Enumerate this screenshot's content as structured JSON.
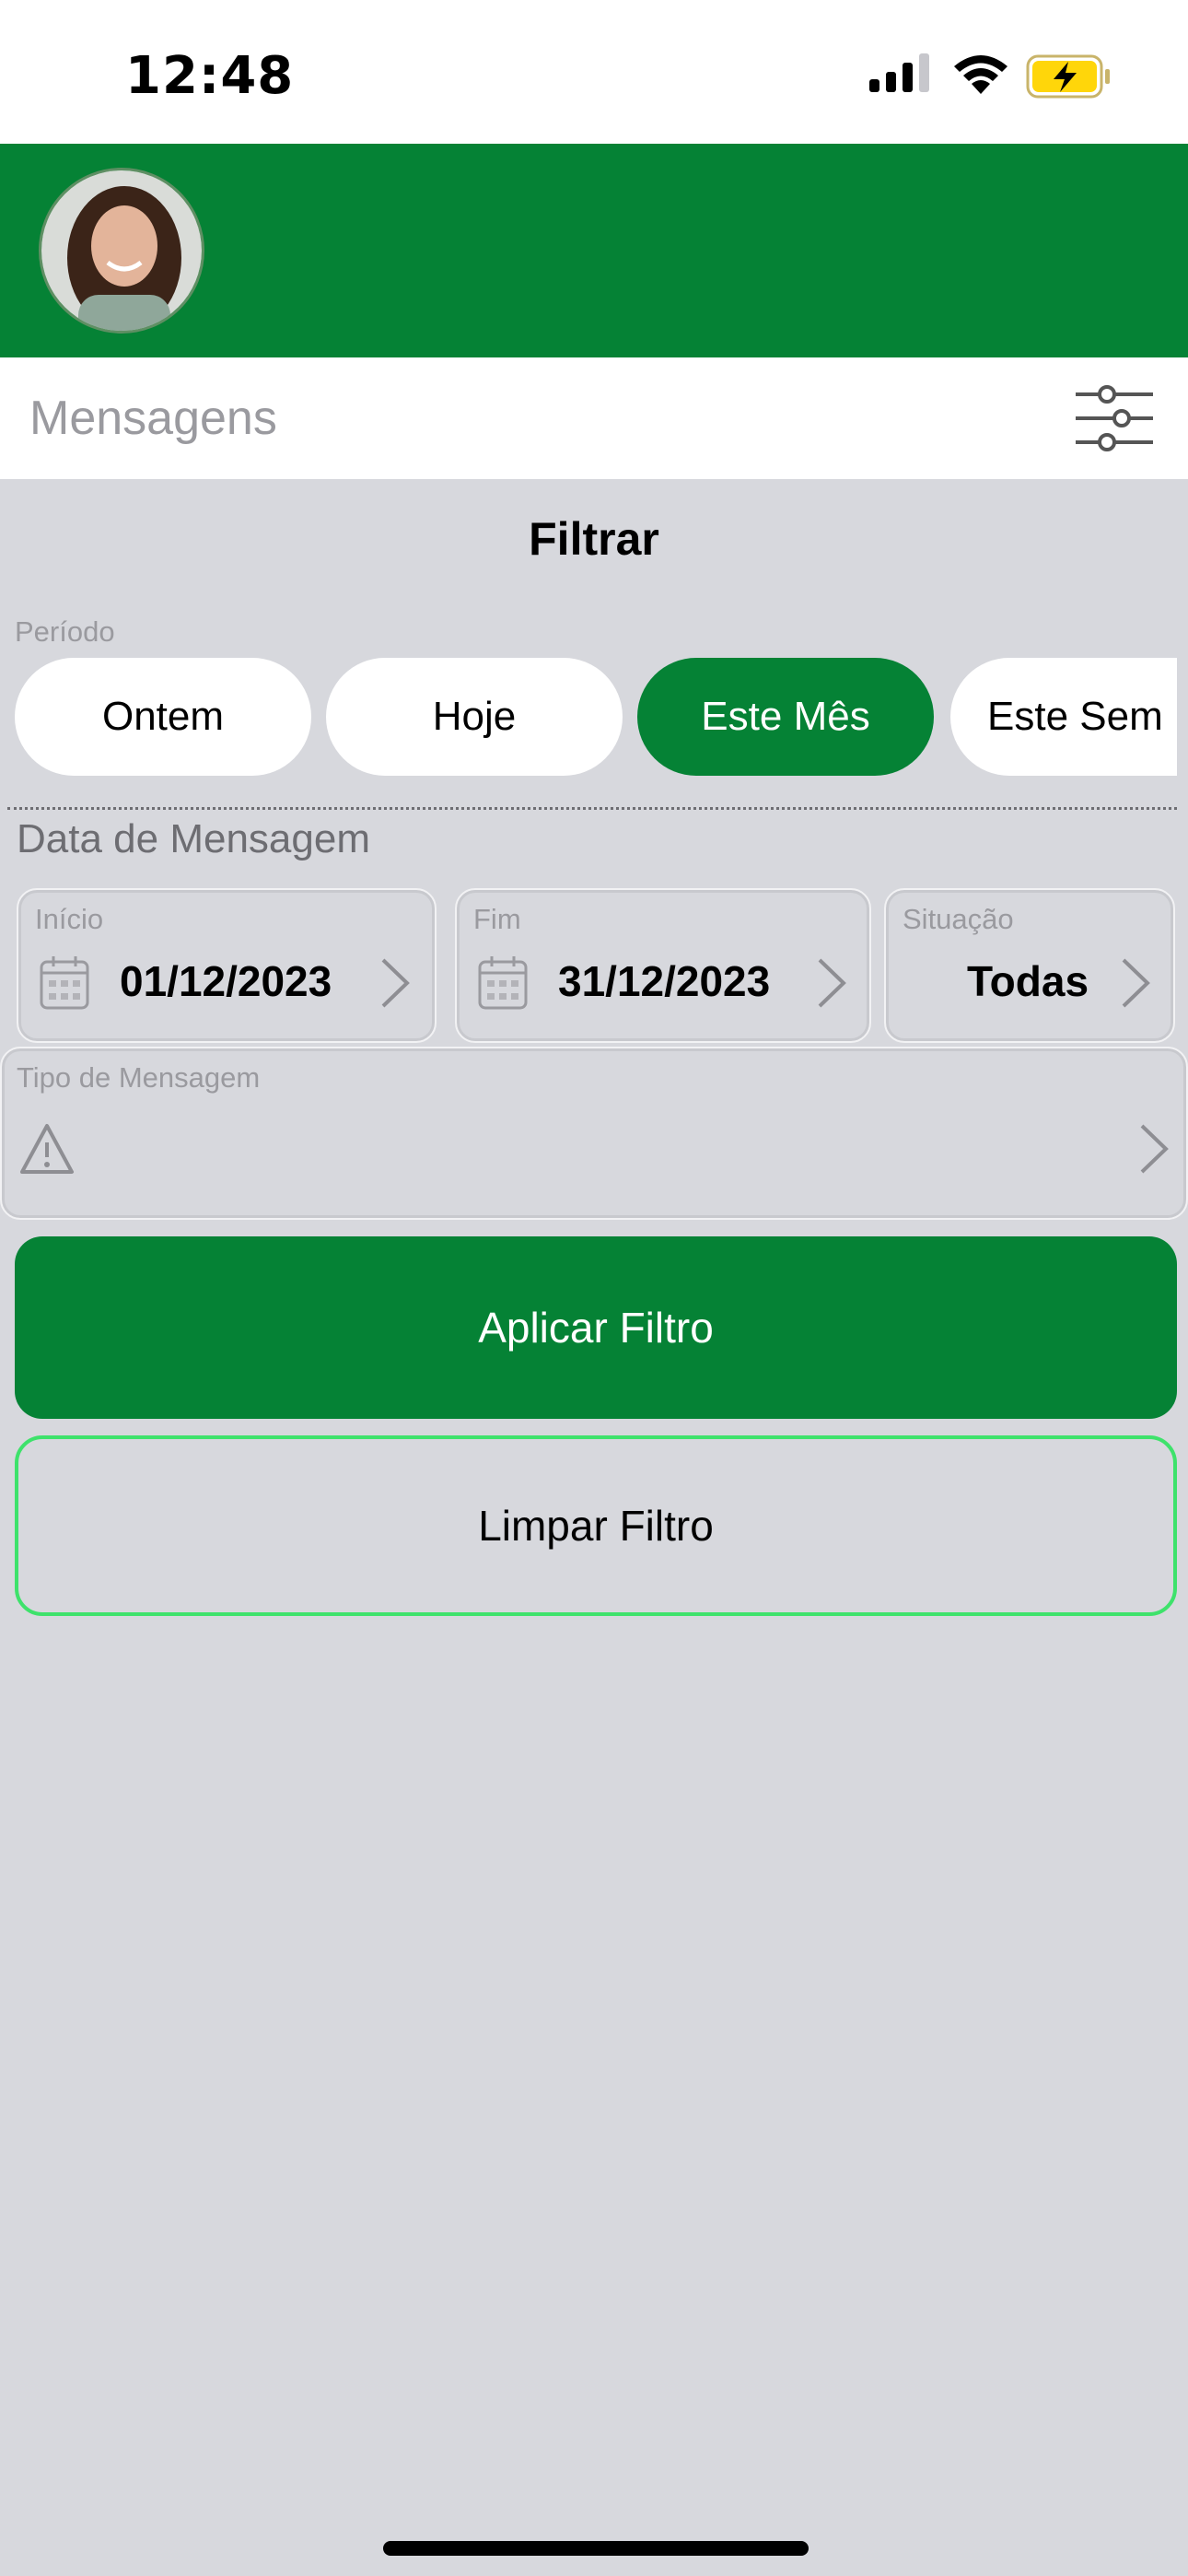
{
  "status_bar": {
    "time": "12:48",
    "battery_color": "#FFD60A"
  },
  "header": {
    "avatar_icon": "user-avatar",
    "color": "#058235"
  },
  "title_bar": {
    "title": "Mensagens",
    "filter_icon": "sliders-icon"
  },
  "filter": {
    "title": "Filtrar",
    "periodo_label": "Período",
    "chips": [
      {
        "label": "Ontem",
        "selected": false
      },
      {
        "label": "Hoje",
        "selected": false
      },
      {
        "label": "Este Mês",
        "selected": true
      },
      {
        "label": "Este Sem",
        "selected": false
      }
    ],
    "data_section_title": "Data de Mensagem",
    "inicio": {
      "label": "Início",
      "value": "01/12/2023"
    },
    "fim": {
      "label": "Fim",
      "value": "31/12/2023"
    },
    "situacao": {
      "label": "Situação",
      "value": "Todas"
    },
    "tipo": {
      "label": "Tipo de Mensagem",
      "value": ""
    },
    "apply_label": "Aplicar Filtro",
    "clear_label": "Limpar Filtro"
  },
  "colors": {
    "accent": "#058235",
    "outline": "#3EE26B",
    "background": "#D7D8DD"
  }
}
